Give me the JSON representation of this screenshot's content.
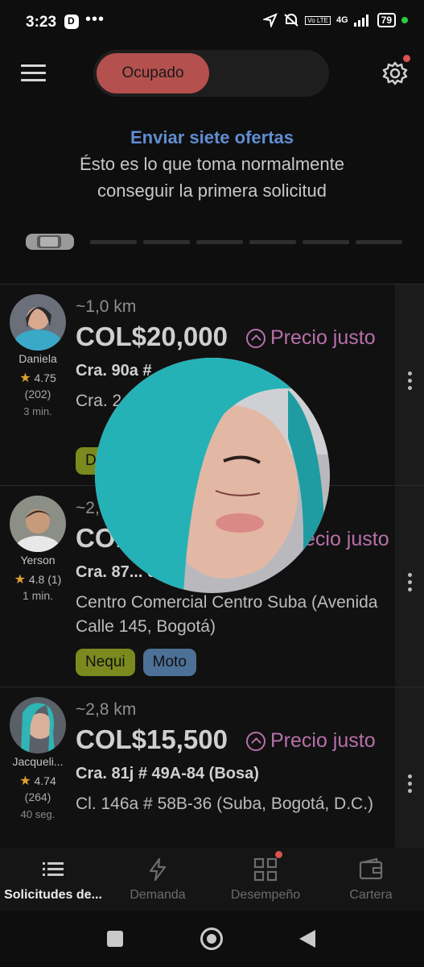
{
  "status_bar": {
    "time": "3:23",
    "dots": "•••",
    "network": "4G",
    "battery": "79"
  },
  "header": {
    "status_toggle": "Ocupado"
  },
  "banner": {
    "title": "Enviar siete ofertas",
    "subtitle": "Ésto es lo que toma normalmente conseguir la primera solicitud"
  },
  "requests": [
    {
      "name": "Daniela",
      "rating": "4.75",
      "count": "(202)",
      "ago": "3 min.",
      "distance": "~1,0 km",
      "price": "COL$20,000",
      "fair_label": "Precio justo",
      "from": "Cra. 90a # ... (Bogotá)",
      "to": "Cra. 2... Bogotá, D.C.",
      "tag1": "D"
    },
    {
      "name": "Yerson",
      "rating": "4.8 (1)",
      "ago": "1 min.",
      "distance": "~2,",
      "price": "COL",
      "fair_label": "ecio justo",
      "from": "Cra. 87... edy)",
      "to": "Centro Comercial Centro Suba (Avenida Calle 145, Bogotá)",
      "tag1": "Nequi",
      "tag2": "Moto"
    },
    {
      "name": "Jacqueli...",
      "rating": "4.74",
      "count": "(264)",
      "ago": "40 seg.",
      "distance": "~2,8 km",
      "price": "COL$15,500",
      "fair_label": "Precio justo",
      "from": "Cra. 81j # 49A-84 (Bosa)",
      "to": "Cl. 146a # 58B-36 (Suba, Bogotá, D.C.)"
    }
  ],
  "bottom_nav": [
    {
      "label": "Solicitudes de..."
    },
    {
      "label": "Demanda"
    },
    {
      "label": "Desempeño"
    },
    {
      "label": "Cartera"
    }
  ],
  "colors": {
    "accent_blue": "#5f8ed1",
    "busy": "#b4504e",
    "fair_price": "#b770a9",
    "nequi": "#7a8a1e",
    "moto": "#4d7096"
  }
}
